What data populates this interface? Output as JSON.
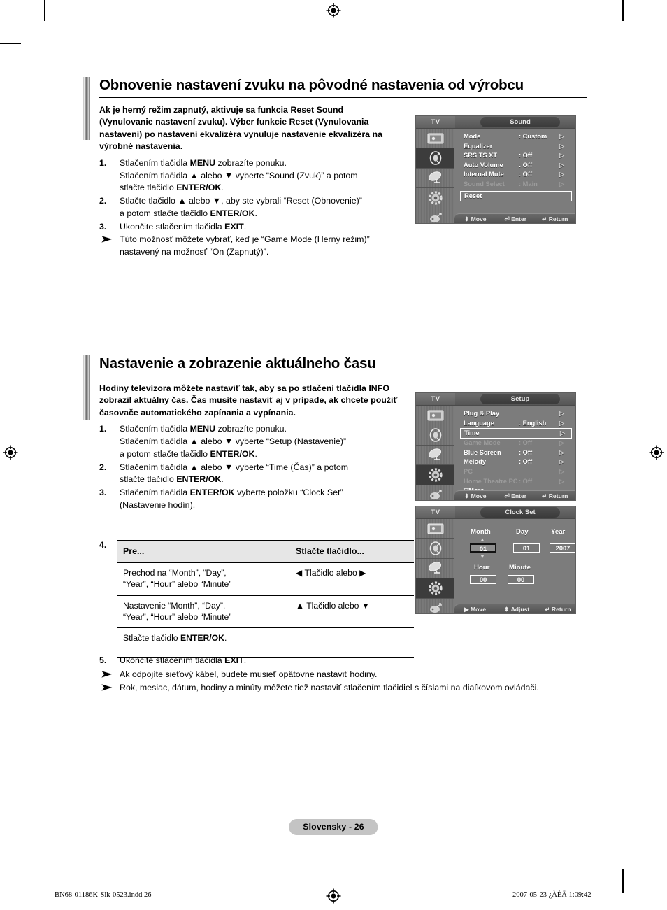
{
  "page": {
    "badge": "Slovensky - 26",
    "print_file": "BN68-01186K-Slk-0523.indd   26",
    "print_date": "2007-05-23   ¿ÀÈÄ 1:09:42"
  },
  "section1": {
    "title": "Obnovenie nastavení zvuku na pôvodné nastavenia od výrobcu",
    "intro": "Ak je herný režim zapnutý, aktivuje sa funkcia Reset Sound (Vynulovanie nastavení zvuku). Výber funkcie Reset (Vynulovania nastavení) po nastavení ekvalizéra vynuluje nastavenie ekvalizéra na výrobné nastavenia.",
    "steps": [
      {
        "num": "1.",
        "line1_a": "Stlačením tlačidla ",
        "line1_b": "MENU",
        "line1_c": " zobrazíte ponuku.",
        "line2_a": "Stlačením tlačidla ▲ alebo ▼ vyberte “Sound (Zvuk)” a potom",
        "line3_a": "stlačte tlačidlo ",
        "line3_b": "ENTER/OK",
        "line3_c": "."
      },
      {
        "num": "2.",
        "line1_a": "Stlačte tlačidlo ▲ alebo ▼, aby ste vybrali “Reset (Obnovenie)”",
        "line2_a": "a potom stlačte tlačidlo ",
        "line2_b": "ENTER/OK",
        "line2_c": "."
      },
      {
        "num": "3.",
        "line1_a": "Ukončite stlačením tlačidla ",
        "line1_b": "EXIT",
        "line1_c": "."
      }
    ],
    "note": "Túto možnosť môžete vybrať, keď je “Game Mode (Herný režim)” nastavený na možnosť “On (Zapnutý)”."
  },
  "section2": {
    "title": "Nastavenie a zobrazenie aktuálneho času",
    "intro": "Hodiny televízora môžete nastaviť tak, aby sa po stlačení tlačidla INFO zobrazil aktuálny čas. Čas musíte nastaviť aj v prípade, ak chcete použiť časovače automatického zapínania a vypínania.",
    "steps": [
      {
        "num": "1.",
        "line1_a": "Stlačením tlačidla ",
        "line1_b": "MENU",
        "line1_c": " zobrazíte ponuku.",
        "line2_a": "Stlačením tlačidla ▲ alebo ▼ vyberte “Setup (Nastavenie)”",
        "line3_a": "a potom stlačte tlačidlo ",
        "line3_b": "ENTER/OK",
        "line3_c": "."
      },
      {
        "num": "2.",
        "line1_a": "Stlačením tlačidla ▲ alebo ▼ vyberte “Time (Čas)” a potom",
        "line2_a": "stlačte tlačidlo ",
        "line2_b": "ENTER/OK",
        "line2_c": "."
      },
      {
        "num": "3.",
        "line1_a": "Stlačením tlačidla ",
        "line1_b": "ENTER/OK",
        "line1_c": " vyberte položku “Clock Set”",
        "line2_a": "(Nastavenie hodín)."
      }
    ],
    "step4_num": "4.",
    "step5": {
      "num": "5.",
      "line1_a": "Ukončite stlačením tlačidla ",
      "line1_b": "EXIT",
      "line1_c": "."
    },
    "notes": [
      "Ak odpojíte sieťový kábel, budete musieť opätovne nastaviť hodiny.",
      "Rok, mesiac, dátum, hodiny a minúty môžete tiež nastaviť stlačením tlačidiel s číslami na diaľkovom ovládači."
    ],
    "table": {
      "headers": [
        "Pre...",
        "Stlačte tlačidlo..."
      ],
      "rows": [
        {
          "left_l1": "Prechod na “Month”, “Day”,",
          "left_l2": "“Year”, “Hour” alebo “Minute”",
          "right": "◀ Tlačidlo alebo ▶"
        },
        {
          "left_l1": "Nastavenie “Month”, “Day”,",
          "left_l2": "“Year”, “Hour” alebo “Minute”",
          "right": "▲ Tlačidlo alebo ▼"
        },
        {
          "left_l1_a": "Stlačte tlačidlo ",
          "left_l1_b": "ENTER/OK",
          "left_l1_c": ".",
          "left_l2": "",
          "right": ""
        }
      ]
    }
  },
  "osd_sound": {
    "tv_label": "TV",
    "title": "Sound",
    "rows": [
      {
        "label": "Mode",
        "value": ": Custom",
        "chev": "▷",
        "dim": false
      },
      {
        "label": "Equalizer",
        "value": "",
        "chev": "▷",
        "dim": false
      },
      {
        "label": "SRS TS XT",
        "value": ": Off",
        "chev": "▷",
        "dim": false
      },
      {
        "label": "Auto Volume",
        "value": ": Off",
        "chev": "▷",
        "dim": false
      },
      {
        "label": "Internal Mute",
        "value": ": Off",
        "chev": "▷",
        "dim": false
      },
      {
        "label": "Sound Select",
        "value": ": Main",
        "chev": "▷",
        "dim": true
      }
    ],
    "selected": {
      "label": "Reset",
      "value": "",
      "chev": ""
    },
    "footer": {
      "move": "Move",
      "enter": "Enter",
      "return": "Return"
    }
  },
  "osd_setup": {
    "tv_label": "TV",
    "title": "Setup",
    "rows_before": [
      {
        "label": "Plug & Play",
        "value": "",
        "chev": "▷",
        "dim": false
      },
      {
        "label": "Language",
        "value": ": English",
        "chev": "▷",
        "dim": false
      }
    ],
    "selected": {
      "label": "Time",
      "value": "",
      "chev": "▷"
    },
    "rows_after": [
      {
        "label": "Game Mode",
        "value": ": Off",
        "chev": "▷",
        "dim": true
      },
      {
        "label": "Blue Screen",
        "value": ": Off",
        "chev": "▷",
        "dim": false
      },
      {
        "label": "Melody",
        "value": ": Off",
        "chev": "▷",
        "dim": false
      },
      {
        "label": "PC",
        "value": "",
        "chev": "▷",
        "dim": true
      },
      {
        "label": "Home Theatre PC",
        "value": ": Off",
        "chev": "▷",
        "dim": true
      }
    ],
    "more": "▽More",
    "footer": {
      "move": "Move",
      "enter": "Enter",
      "return": "Return"
    }
  },
  "osd_clock": {
    "tv_label": "TV",
    "title": "Clock Set",
    "labels": {
      "month": "Month",
      "day": "Day",
      "year": "Year",
      "hour": "Hour",
      "minute": "Minute"
    },
    "values": {
      "month": "01",
      "day": "01",
      "year": "2007",
      "hour": "00",
      "minute": "00"
    },
    "footer": {
      "move": "Move",
      "adjust": "Adjust",
      "return": "Return"
    }
  }
}
